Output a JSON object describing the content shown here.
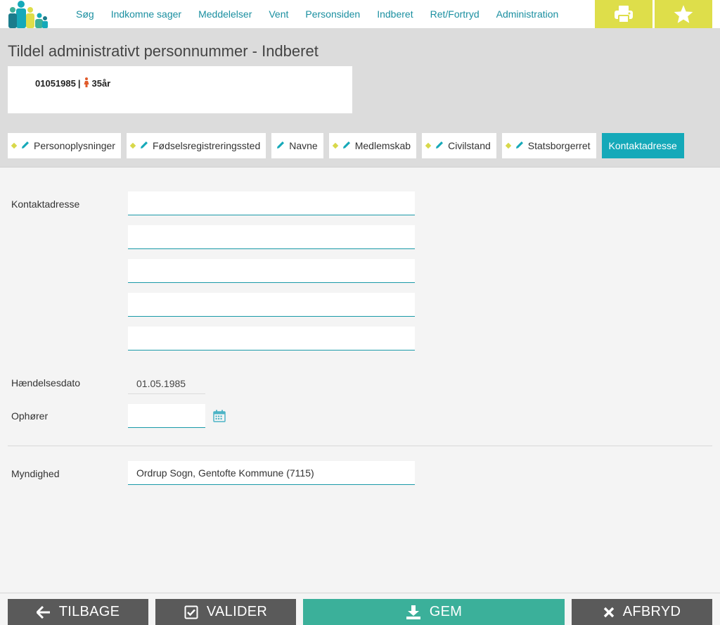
{
  "nav": {
    "links": [
      "Søg",
      "Indkomne sager",
      "Meddelelser",
      "Vent",
      "Personsiden",
      "Indberet",
      "Ret/Fortryd",
      "Administration"
    ],
    "print_icon": "printer-icon",
    "star_icon": "star-icon"
  },
  "header": {
    "title": "Tildel administrativt personnummer - Indberet",
    "person": {
      "cpr": "01051985",
      "separator": "|",
      "age": "35år"
    }
  },
  "tabs": [
    {
      "label": "Personoplysninger",
      "dot": true,
      "pen": true,
      "active": false
    },
    {
      "label": "Fødselsregistreringssted",
      "dot": true,
      "pen": true,
      "active": false
    },
    {
      "label": "Navne",
      "dot": false,
      "pen": true,
      "active": false
    },
    {
      "label": "Medlemskab",
      "dot": true,
      "pen": true,
      "active": false
    },
    {
      "label": "Civilstand",
      "dot": true,
      "pen": true,
      "active": false
    },
    {
      "label": "Statsborgerret",
      "dot": true,
      "pen": true,
      "active": false
    },
    {
      "label": "Kontaktadresse",
      "dot": false,
      "pen": false,
      "active": true
    }
  ],
  "form": {
    "address_label": "Kontaktadresse",
    "address_lines": [
      "",
      "",
      "",
      "",
      ""
    ],
    "event_date_label": "Hændelsesdato",
    "event_date_value": "01.05.1985",
    "ends_label": "Ophører",
    "ends_value": "",
    "authority_label": "Myndighed",
    "authority_value": "Ordrup Sogn, Gentofte Kommune (7115)"
  },
  "footer": {
    "back": "TILBAGE",
    "validate": "VALIDER",
    "save": "GEM",
    "cancel": "AFBRYD"
  },
  "colors": {
    "accent": "#15a9b9",
    "link": "#1a8fa0",
    "yellow": "#dede4a",
    "save_green": "#3bb09a",
    "dark_button": "#5a5a5a"
  }
}
